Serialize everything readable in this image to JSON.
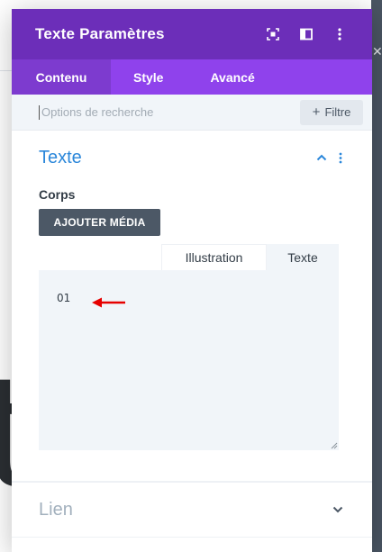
{
  "modal": {
    "title": "Texte Paramètres",
    "header_icons": [
      "expand-icon",
      "split-view-icon",
      "more-vertical-icon"
    ],
    "tabs": [
      {
        "label": "Contenu",
        "active": true
      },
      {
        "label": "Style",
        "active": false
      },
      {
        "label": "Avancé",
        "active": false
      }
    ]
  },
  "search": {
    "placeholder": "Options de recherche",
    "filter_label": "Filtre"
  },
  "sections": {
    "text": {
      "title": "Texte",
      "body_label": "Corps",
      "add_media_label": "AJOUTER MÉDIA",
      "editor_tabs": [
        "Illustration",
        "Texte"
      ],
      "active_editor_tab": "Texte",
      "content": "01"
    },
    "link": {
      "title": "Lien"
    }
  },
  "colors": {
    "header": "#6c2eb9",
    "tabs": "#8f42ec",
    "accent_blue": "#2b87da",
    "annotation_arrow": "#e60000"
  }
}
